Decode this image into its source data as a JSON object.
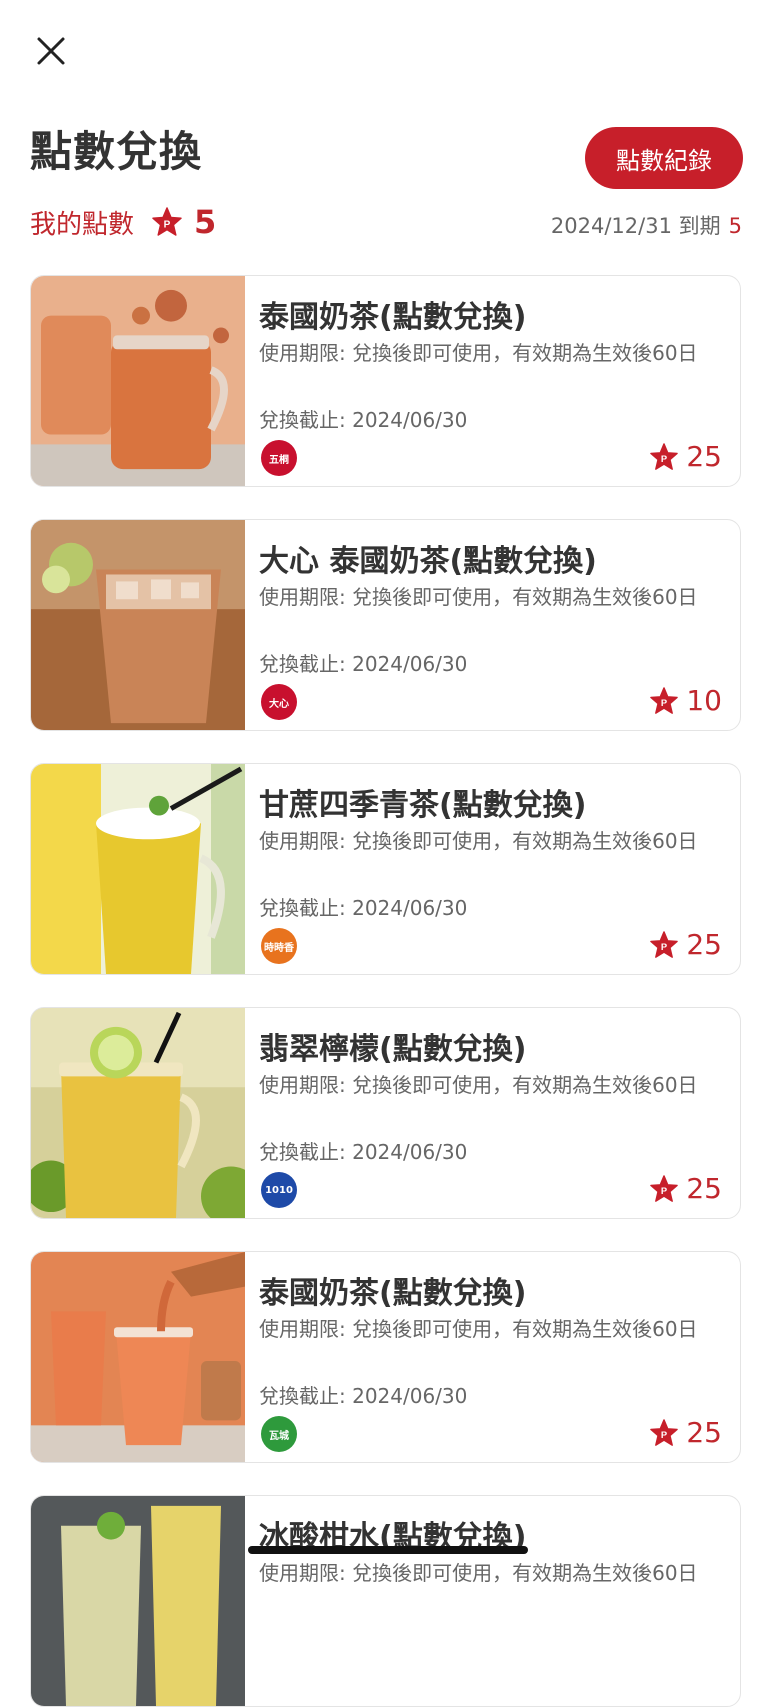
{
  "header": {
    "title": "點數兌換",
    "history_button": "點數紀錄"
  },
  "points": {
    "label": "我的點數",
    "value": "5",
    "expiry_text": "2024/12/31 到期",
    "expiry_count": "5"
  },
  "rewards": [
    {
      "name": "泰國奶茶(點數兌換)",
      "validity": "使用期限: 兌換後即可使用，有效期為生效後60日",
      "deadline": "兌換截止: 2024/06/30",
      "brand": "五桐號",
      "brand_text": "五桐",
      "brand_color": "#c8102e",
      "points": "25",
      "image": "thai-milk-tea"
    },
    {
      "name": "大心 泰國奶茶(點數兌換)",
      "validity": "使用期限: 兌換後即可使用，有效期為生效後60日",
      "deadline": "兌換截止: 2024/06/30",
      "brand": "大心",
      "brand_text": "大心",
      "brand_color": "#c8102e",
      "points": "10",
      "image": "iced-thai-milk-tea"
    },
    {
      "name": "甘蔗四季青茶(點數兌換)",
      "validity": "使用期限: 兌換後即可使用，有效期為生效後60日",
      "deadline": "兌換截止: 2024/06/30",
      "brand": "時時香",
      "brand_text": "時時香",
      "brand_color": "#e8731e",
      "points": "25",
      "image": "sugarcane-tea"
    },
    {
      "name": "翡翠檸檬(點數兌換)",
      "validity": "使用期限: 兌換後即可使用，有效期為生效後60日",
      "deadline": "兌換截止: 2024/06/30",
      "brand": "1010湘",
      "brand_text": "1010",
      "brand_color": "#1e4aa8",
      "points": "25",
      "image": "jade-lemon"
    },
    {
      "name": "泰國奶茶(點數兌換)",
      "validity": "使用期限: 兌換後即可使用，有效期為生效後60日",
      "deadline": "兌換截止: 2024/06/30",
      "brand": "瓦城",
      "brand_text": "瓦城",
      "brand_color": "#2e9a3c",
      "points": "25",
      "image": "thai-milk-tea-pour"
    },
    {
      "name": "冰酸柑水(點數兌換)",
      "validity": "使用期限: 兌換後即可使用，有效期為生效後60日",
      "deadline": "",
      "brand": "",
      "brand_text": "",
      "brand_color": "#c8102e",
      "points": "",
      "image": "lime-juice"
    }
  ],
  "colors": {
    "accent": "#c71f2a",
    "text": "#333333",
    "muted": "#666666"
  }
}
